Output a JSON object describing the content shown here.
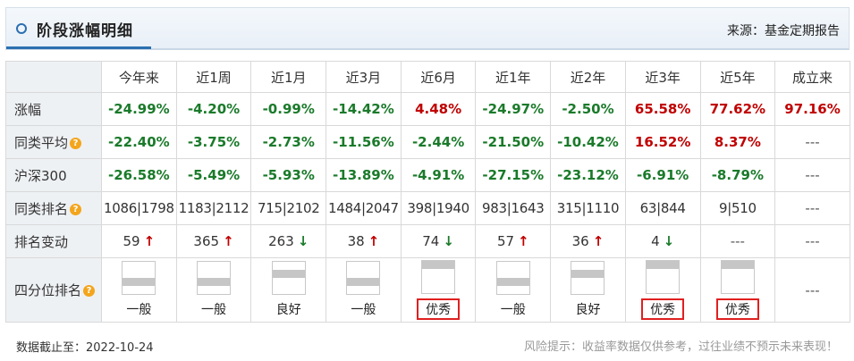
{
  "header": {
    "title": "阶段涨幅明细",
    "source": "来源：基金定期报告"
  },
  "columns": [
    "今年来",
    "近1周",
    "近1月",
    "近3月",
    "近6月",
    "近1年",
    "近2年",
    "近3年",
    "近5年",
    "成立来"
  ],
  "rows": {
    "growth": {
      "label": "涨幅",
      "values": [
        "-24.99%",
        "-4.20%",
        "-0.99%",
        "-14.42%",
        "4.48%",
        "-24.97%",
        "-2.50%",
        "65.58%",
        "77.62%",
        "97.16%"
      ],
      "signs": [
        "neg",
        "neg",
        "neg",
        "neg",
        "pos",
        "neg",
        "neg",
        "pos",
        "pos",
        "pos"
      ]
    },
    "peer_avg": {
      "label": "同类平均",
      "values": [
        "-22.40%",
        "-3.75%",
        "-2.73%",
        "-11.56%",
        "-2.44%",
        "-21.50%",
        "-10.42%",
        "16.52%",
        "8.37%",
        "---"
      ],
      "signs": [
        "neg",
        "neg",
        "neg",
        "neg",
        "neg",
        "neg",
        "neg",
        "pos",
        "pos",
        "dash"
      ]
    },
    "hs300": {
      "label": "沪深300",
      "values": [
        "-26.58%",
        "-5.49%",
        "-5.93%",
        "-13.89%",
        "-4.91%",
        "-27.15%",
        "-23.12%",
        "-6.91%",
        "-8.79%",
        "---"
      ],
      "signs": [
        "neg",
        "neg",
        "neg",
        "neg",
        "neg",
        "neg",
        "neg",
        "neg",
        "neg",
        "dash"
      ]
    },
    "peer_rank": {
      "label": "同类排名",
      "values": [
        "1086|1798",
        "1183|2112",
        "715|2102",
        "1484|2047",
        "398|1940",
        "983|1643",
        "315|1110",
        "63|844",
        "9|510",
        "---"
      ]
    },
    "rank_change": {
      "label": "排名变动",
      "values": [
        "59",
        "365",
        "263",
        "38",
        "74",
        "57",
        "36",
        "4",
        "---",
        "---"
      ],
      "arrows": [
        "↑",
        "↑",
        "↓",
        "↑",
        "↓",
        "↑",
        "↑",
        "↓",
        "",
        ""
      ],
      "dirs": [
        "up",
        "up",
        "down",
        "up",
        "down",
        "up",
        "up",
        "down",
        "",
        ""
      ]
    },
    "quartile": {
      "label": "四分位排名",
      "labels": [
        "一般",
        "一般",
        "良好",
        "一般",
        "优秀",
        "一般",
        "良好",
        "优秀",
        "优秀",
        "---"
      ],
      "levels": [
        2,
        2,
        3,
        2,
        4,
        2,
        3,
        4,
        4,
        0
      ],
      "highlight": [
        false,
        false,
        false,
        false,
        true,
        false,
        false,
        true,
        true,
        false
      ]
    }
  },
  "footer": {
    "date": "数据截止至：2022-10-24",
    "risk": "风险提示：收益率数据仅供参考，过往业绩不预示未来表现！"
  },
  "colors": {
    "positive": "#c00000",
    "negative": "#1a7a2a",
    "accent": "#2a6fb0",
    "highlight_box": "#e02020",
    "help_icon": "#f3a51c"
  },
  "icons": {
    "title": "ring-icon",
    "help": "question-mark-icon"
  }
}
